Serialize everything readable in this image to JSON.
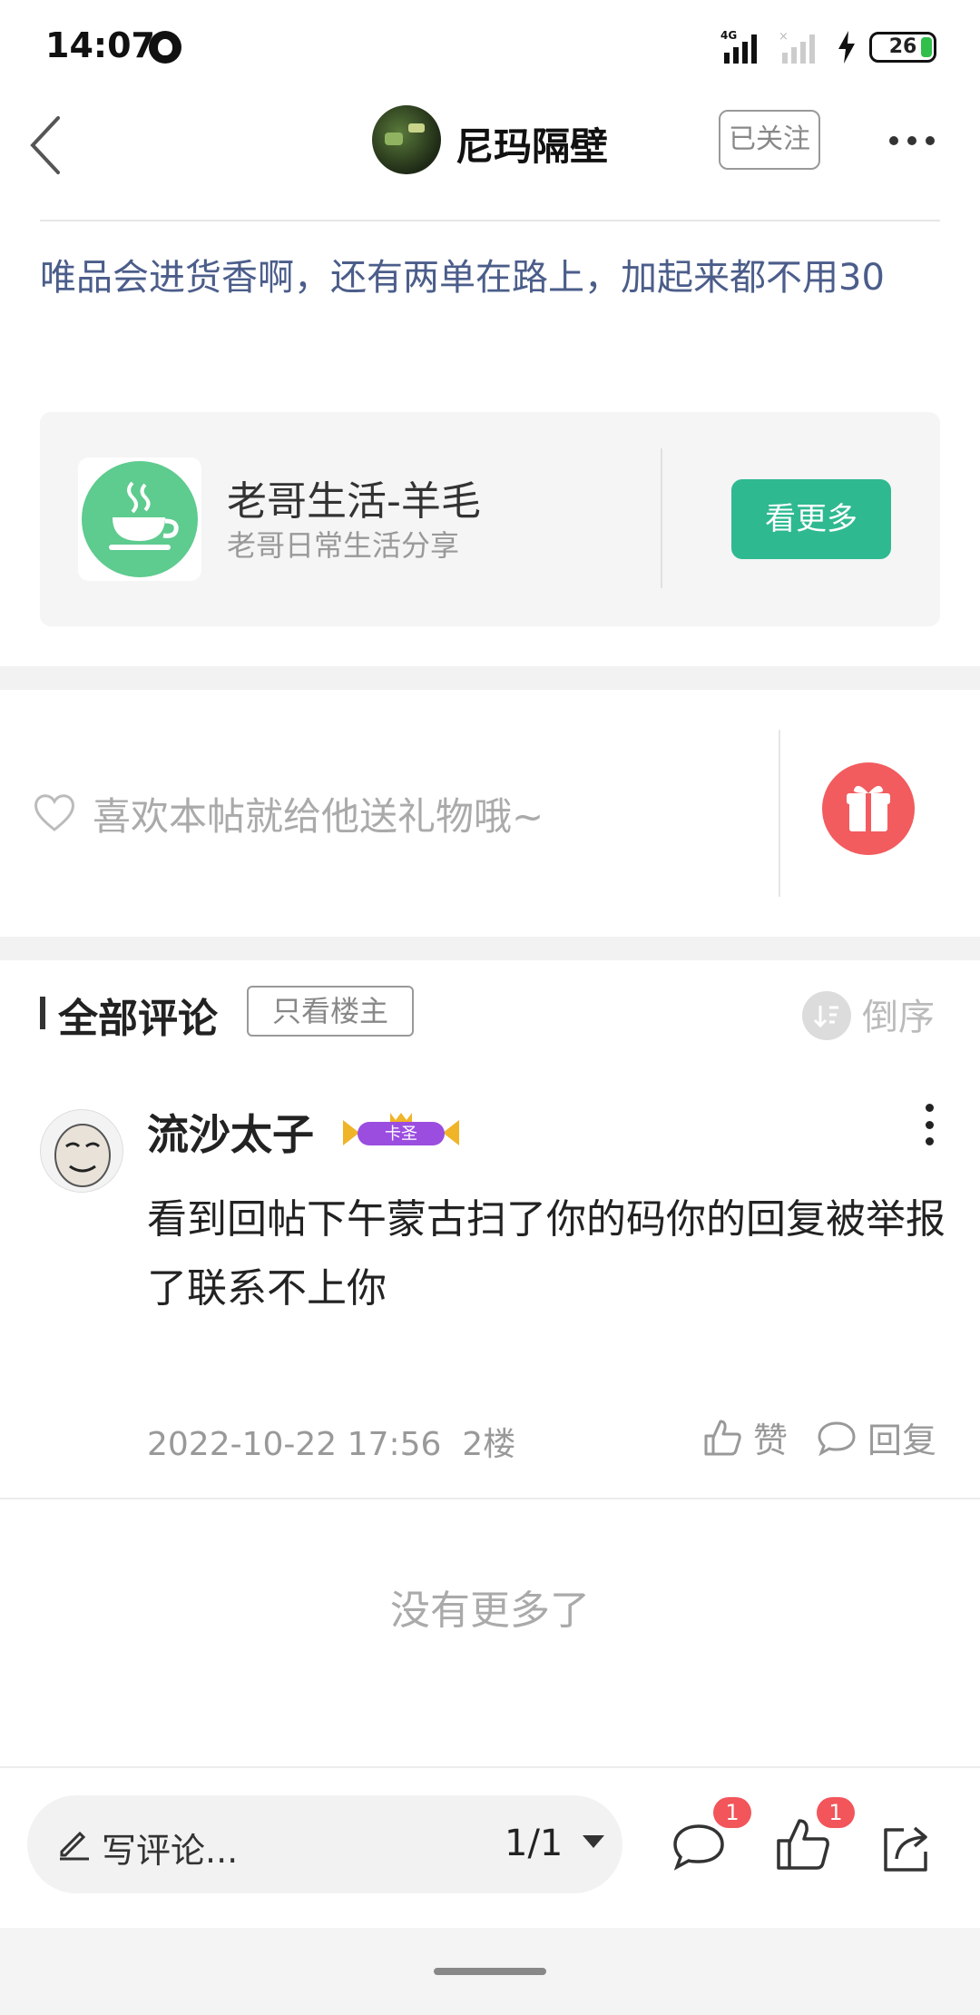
{
  "status_bar": {
    "time": "14:07",
    "network": "4G",
    "battery": "26"
  },
  "header": {
    "author_name": "尼玛隔壁",
    "follow_label": "已关注"
  },
  "post": {
    "text": "唯品会进货香啊，还有两单在路上，加起来都不用30"
  },
  "forum_card": {
    "name": "老哥生活-羊毛",
    "description": "老哥日常生活分享",
    "button_label": "看更多",
    "accent": "#2fb991"
  },
  "gift": {
    "prompt": "喜欢本帖就给他送礼物哦~",
    "button_color": "#f25c5f"
  },
  "comments": {
    "title": "全部评论",
    "only_op_label": "只看楼主",
    "sort_label": "倒序",
    "items": [
      {
        "username": "流沙太子",
        "badge_text": "卡圣",
        "text": "看到回帖下午蒙古扫了你的码你的回复被举报了联系不上你",
        "datetime": "2022-10-22 17:56",
        "floor": "2楼",
        "like_label": "赞",
        "reply_label": "回复"
      }
    ],
    "end_text": "没有更多了"
  },
  "bottom_bar": {
    "write_placeholder": "写评论...",
    "page": "1/1",
    "comment_badge": "1",
    "like_badge": "1"
  }
}
